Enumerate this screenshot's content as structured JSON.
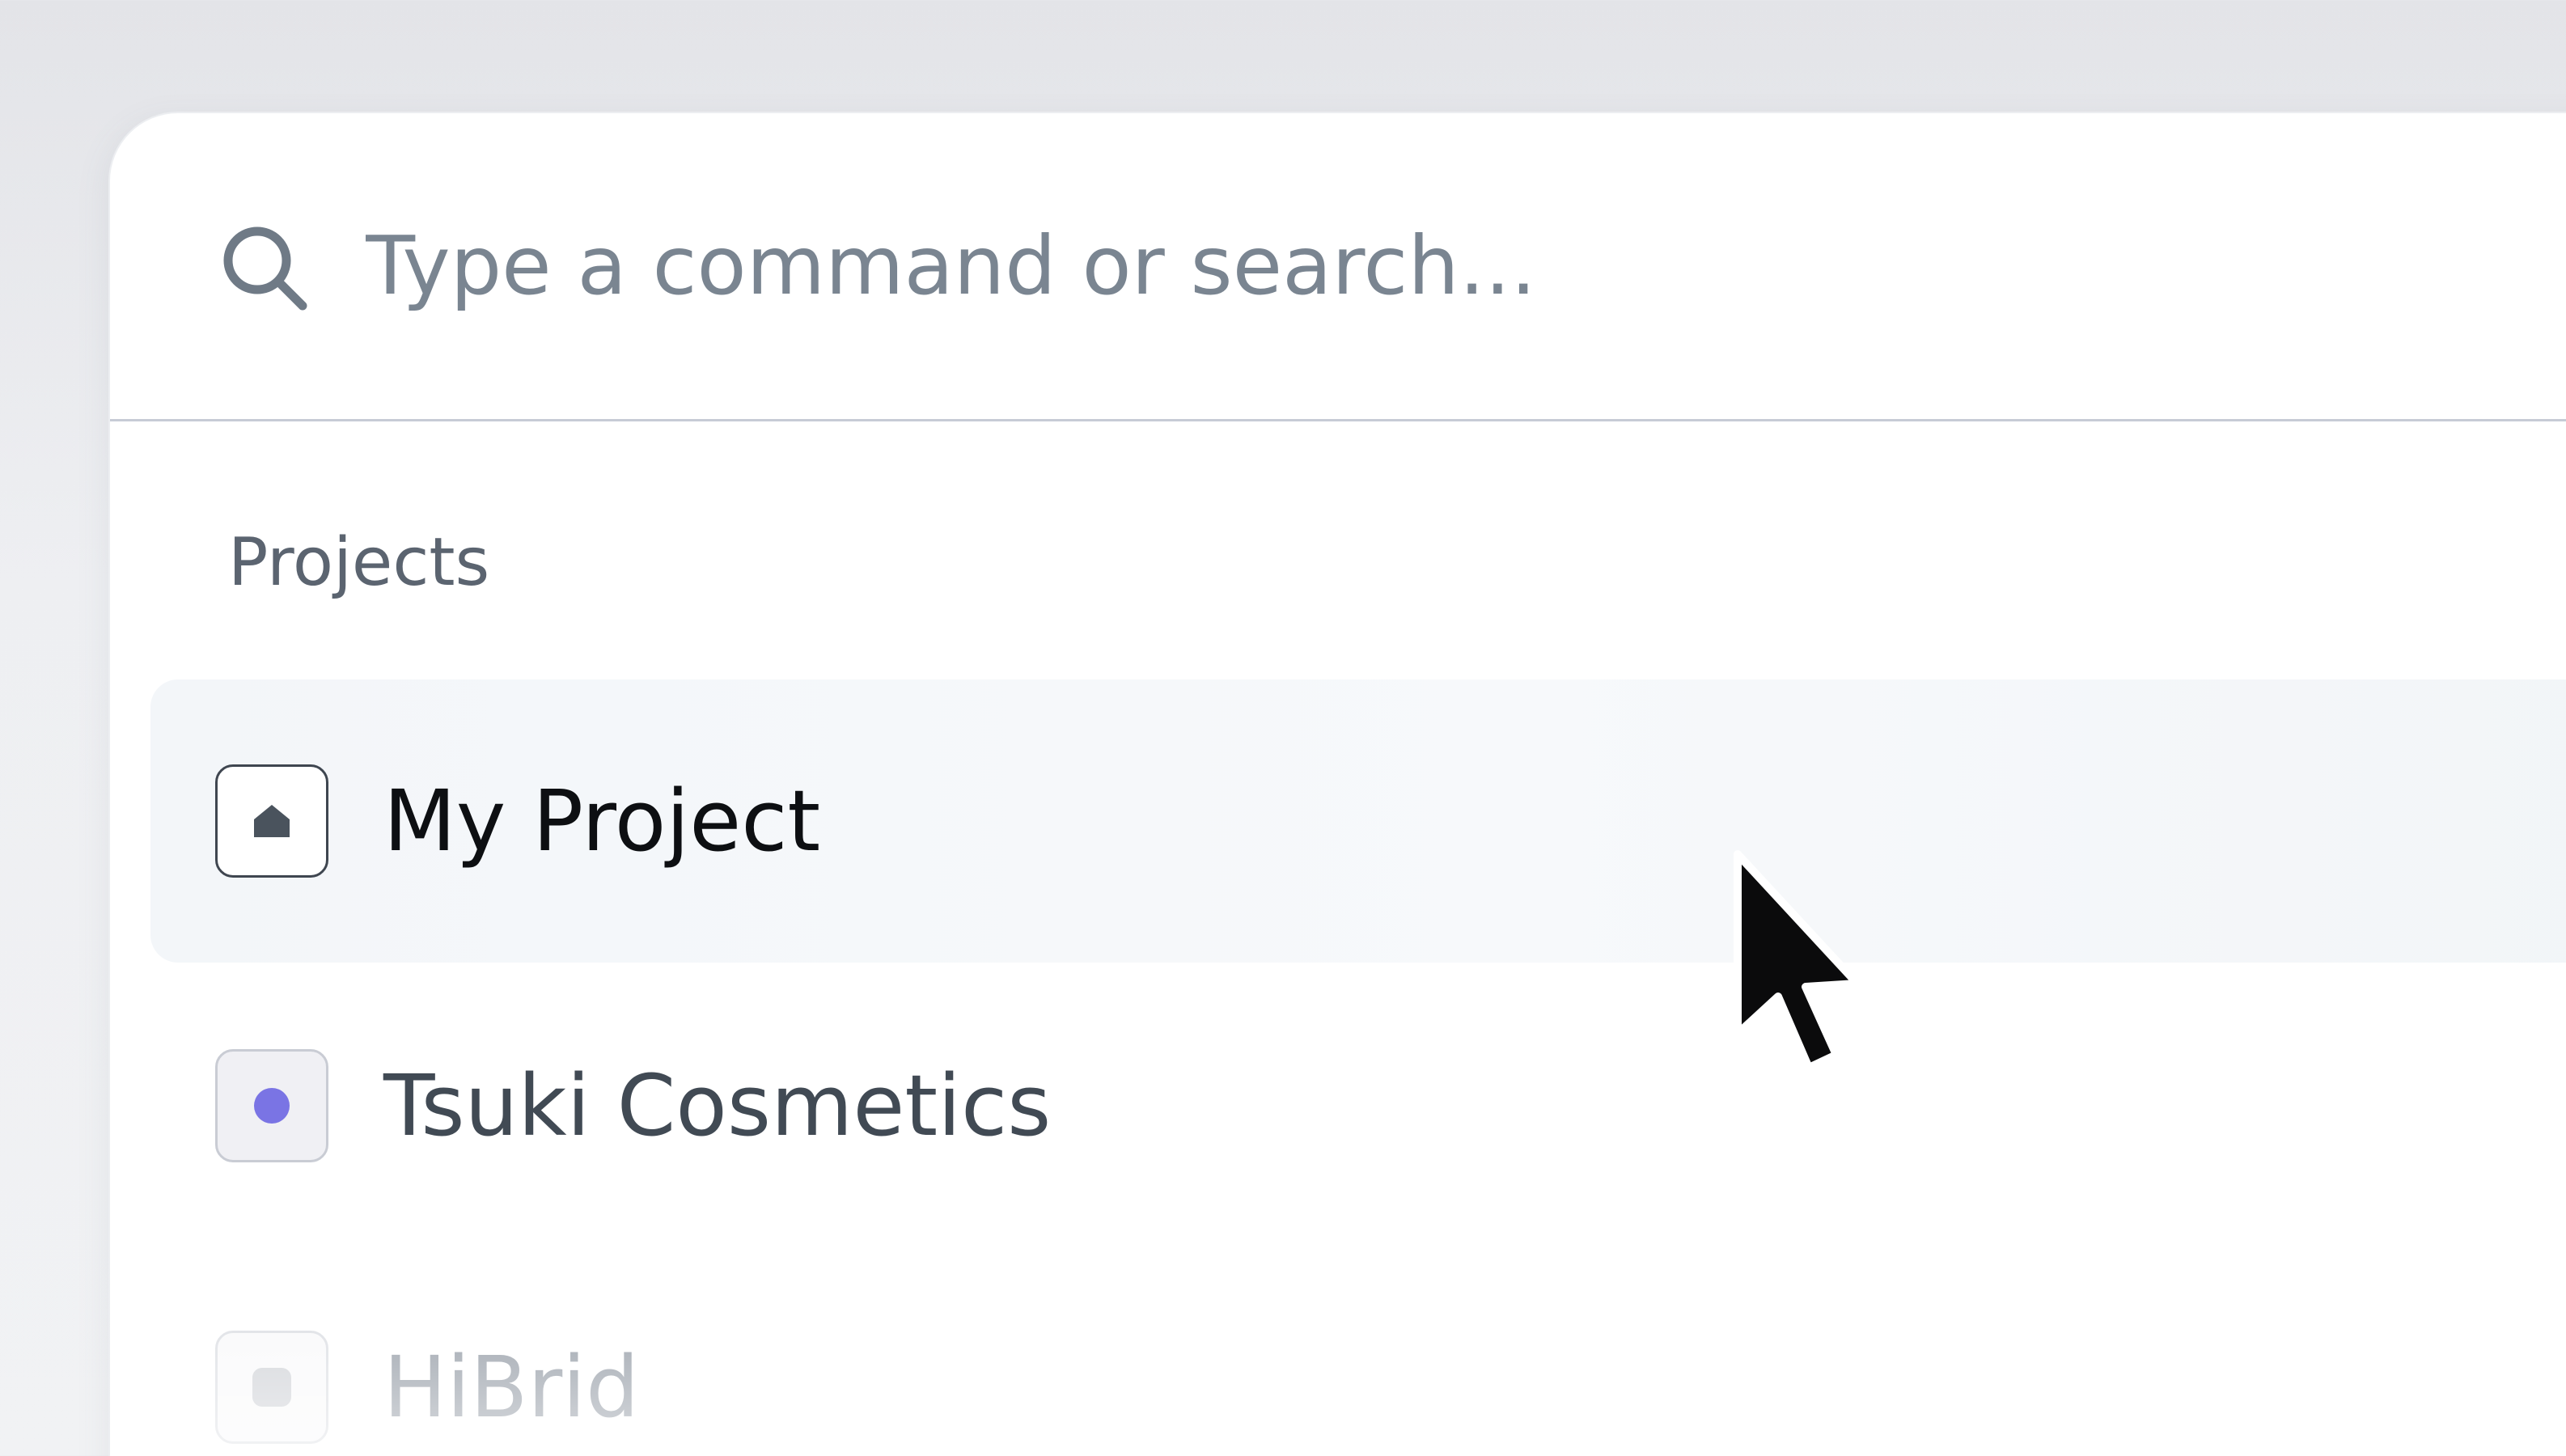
{
  "search": {
    "placeholder": "Type a command or search...",
    "icon": "search-icon"
  },
  "groups": [
    {
      "label": "Projects",
      "items": [
        {
          "label": "My Project",
          "icon": "home-icon",
          "state": "highlighted"
        },
        {
          "label": "Tsuki Cosmetics",
          "icon": "purple-dot-icon",
          "icon_color": "#7a74e4"
        },
        {
          "label": "HiBrid",
          "icon": "gray-square-icon"
        }
      ]
    }
  ],
  "colors": {
    "highlight_bg": "#f4f7fa",
    "accent_purple": "#7a74e4",
    "divider": "#c7cbd6"
  }
}
